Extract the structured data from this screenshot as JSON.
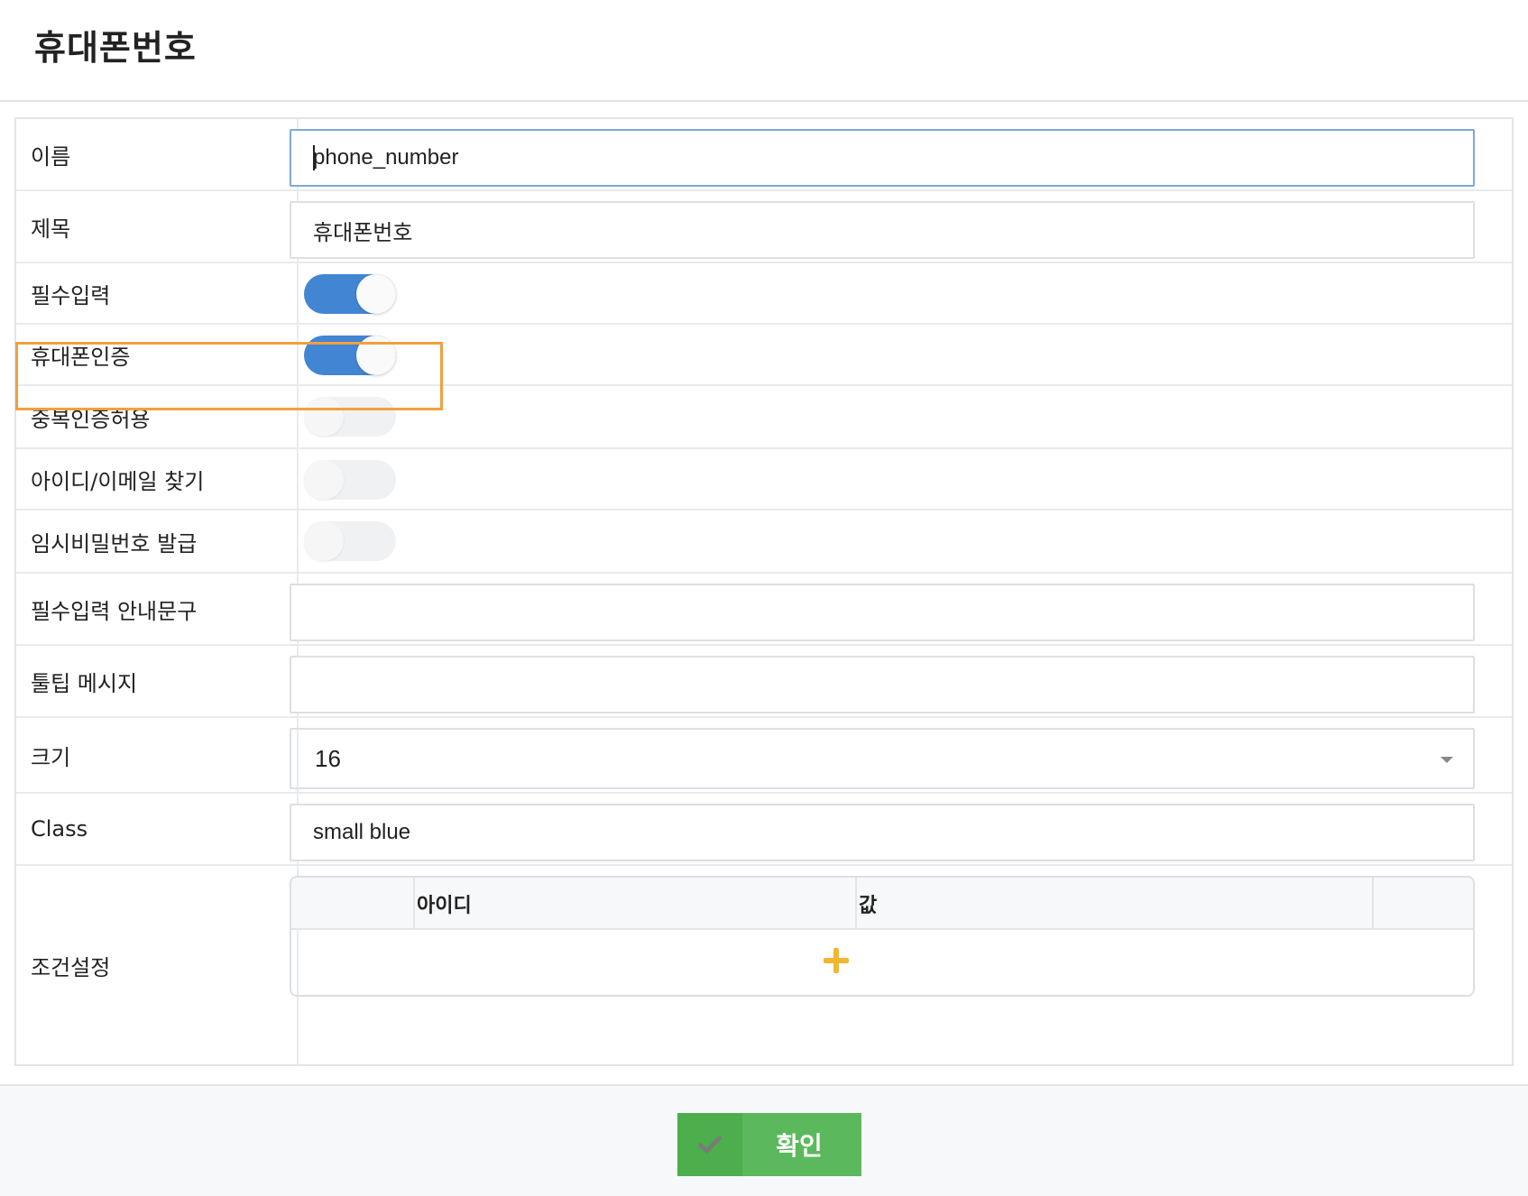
{
  "header": {
    "title": "휴대폰번호"
  },
  "form": {
    "name": {
      "label": "이름",
      "value": "phone_number"
    },
    "title": {
      "label": "제목",
      "value": "휴대폰번호"
    },
    "required": {
      "label": "필수입력",
      "on": true
    },
    "phone_auth": {
      "label": "휴대폰인증",
      "on": true
    },
    "duplicate_auth": {
      "label": "중복인증허용",
      "on": false
    },
    "find_id_email": {
      "label": "아이디/이메일 찾기",
      "on": false
    },
    "temp_password": {
      "label": "임시비밀번호 발급",
      "on": false
    },
    "required_guide": {
      "label": "필수입력 안내문구",
      "value": ""
    },
    "tooltip": {
      "label": "툴팁 메시지",
      "value": ""
    },
    "size": {
      "label": "크기",
      "value": "16"
    },
    "class": {
      "label": "Class",
      "value": "small blue"
    },
    "conditions": {
      "label": "조건설정",
      "columns": [
        "아이디",
        "값"
      ],
      "add_icon": "plus-icon"
    }
  },
  "footer": {
    "confirm_label": "확인",
    "confirm_icon": "check-icon"
  },
  "colors": {
    "toggle_on": "#4285d2",
    "highlight": "#f0a040",
    "confirm": "#5cb85c",
    "add": "#f2b632"
  }
}
